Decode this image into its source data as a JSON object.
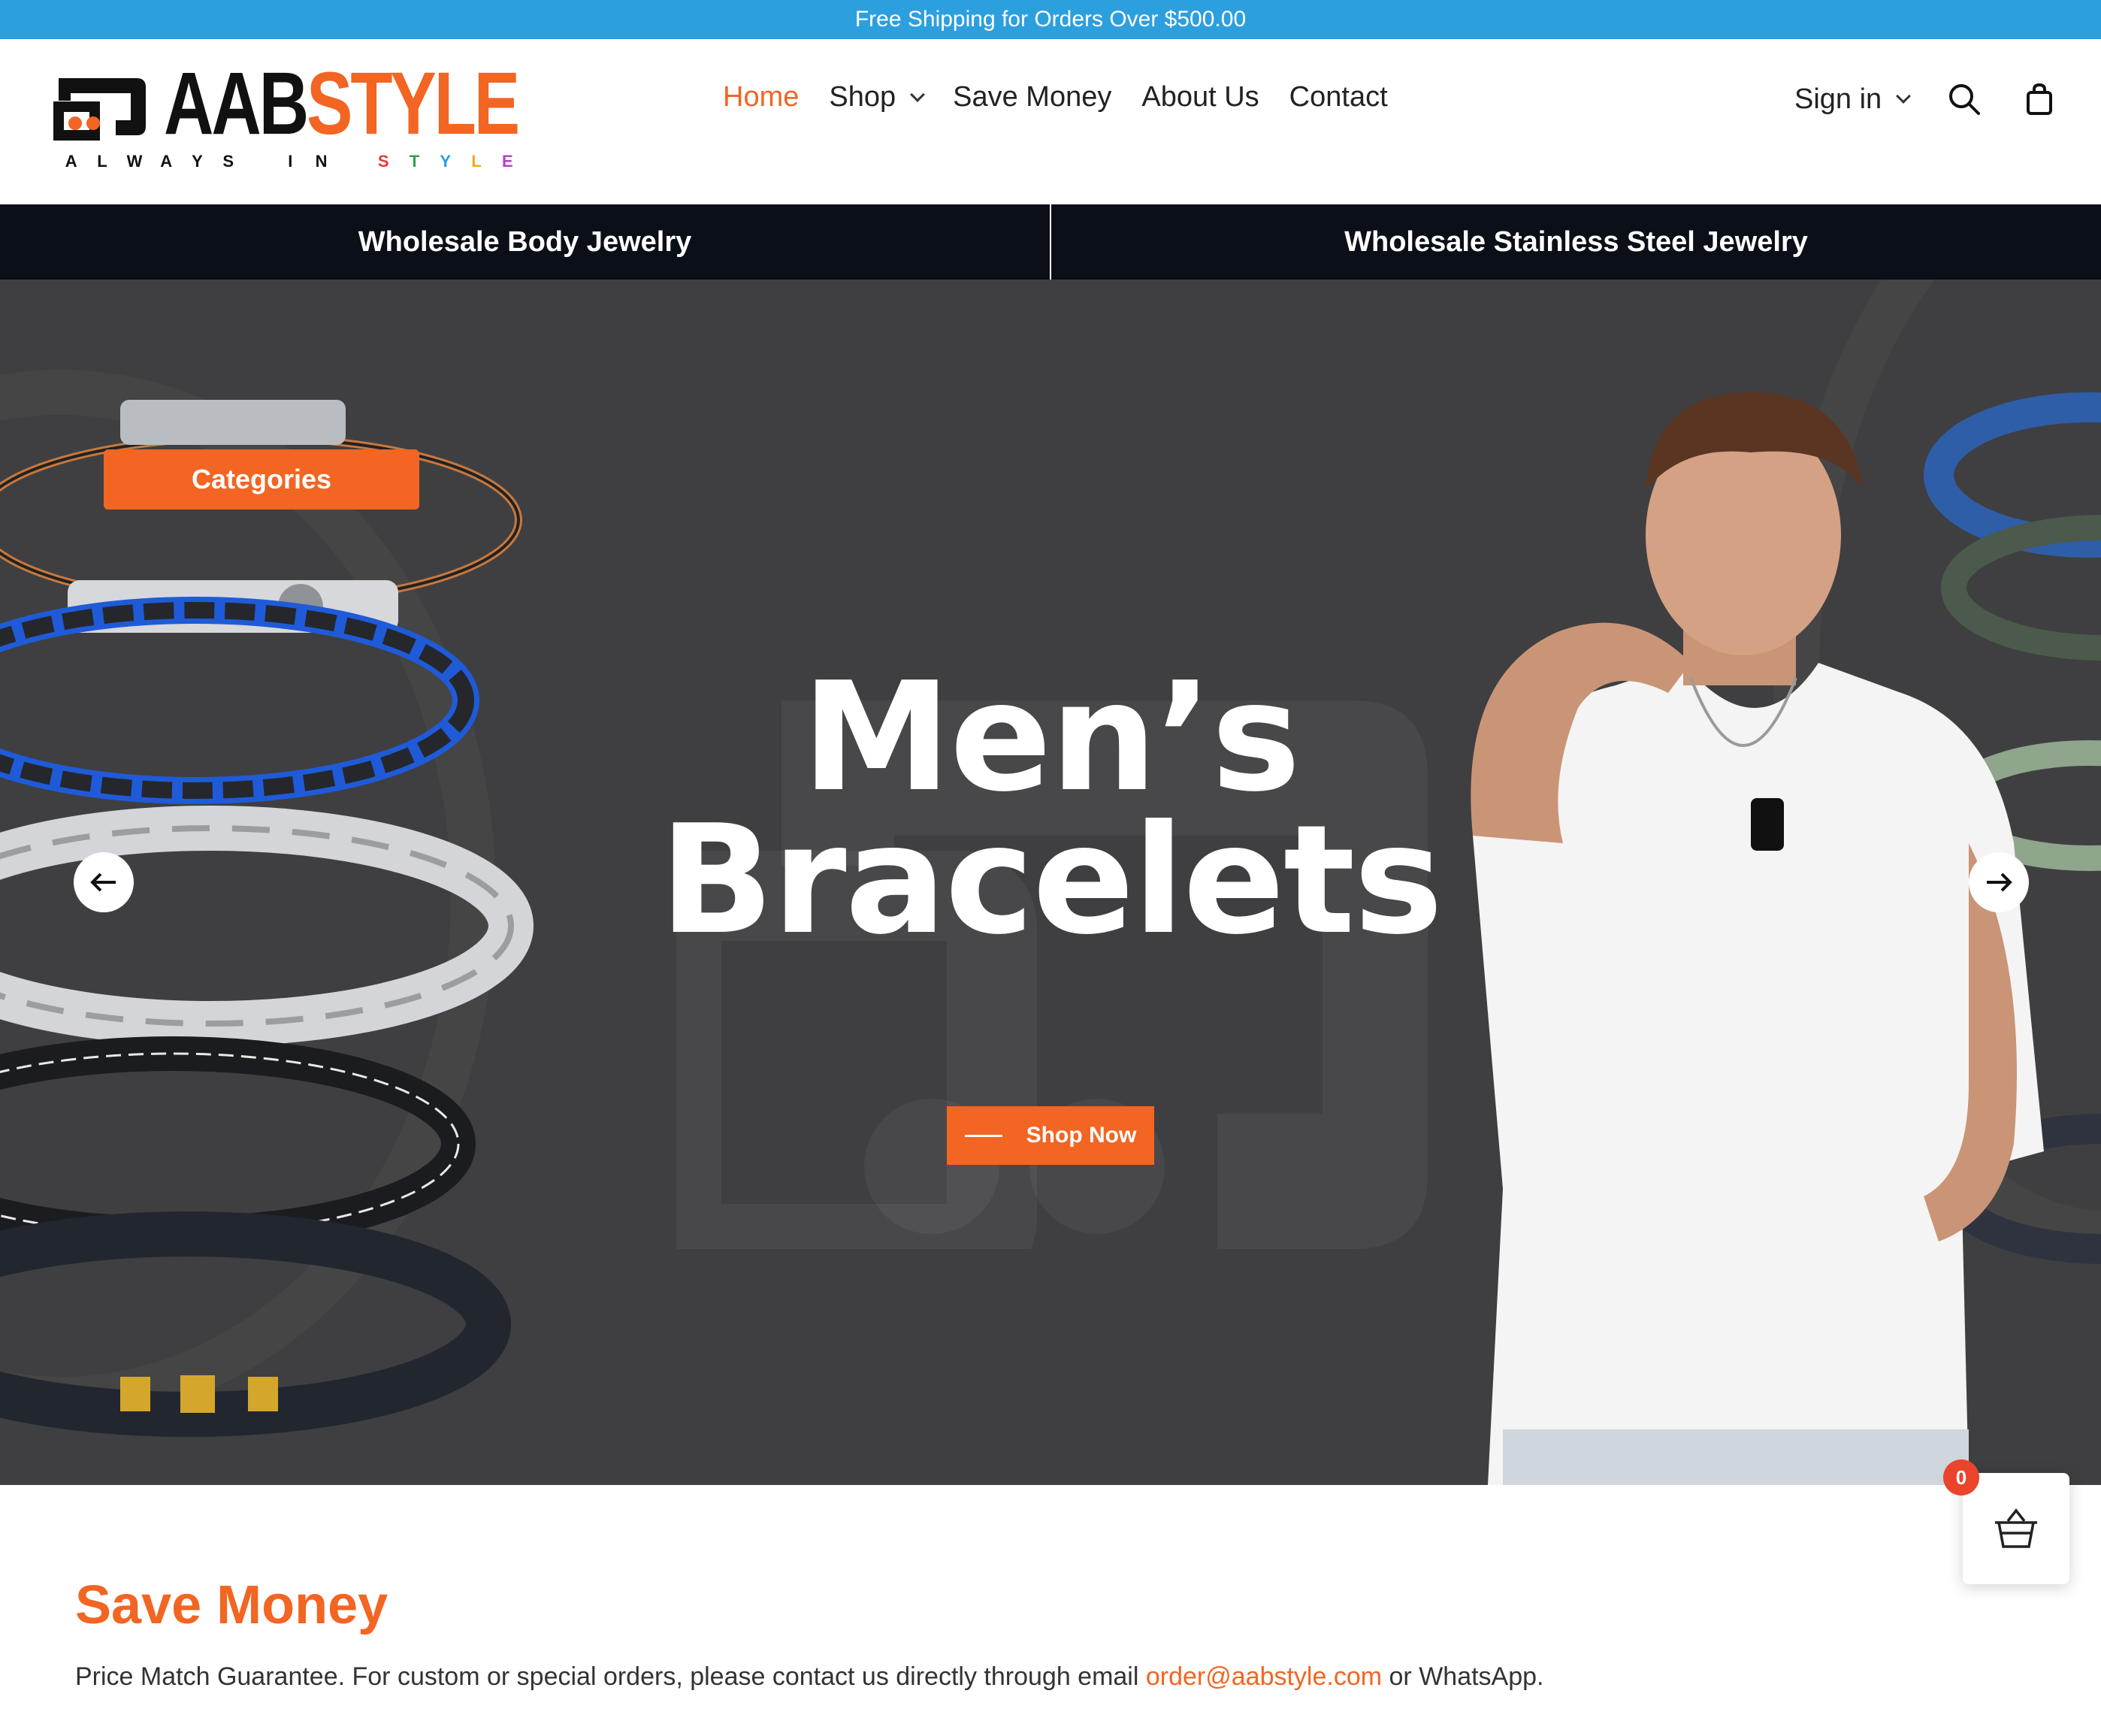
{
  "announcement": {
    "text": "Free Shipping for Orders Over $500.00"
  },
  "logo": {
    "brand_a": "AAB",
    "brand_b": "STYLE",
    "tagline_letters": [
      "A",
      "L",
      "W",
      "A",
      "Y",
      "S",
      "",
      "I",
      "N",
      "",
      "S",
      "T",
      "Y",
      "L",
      "E"
    ],
    "accent_color": "#f26522"
  },
  "nav": {
    "items": [
      {
        "label": "Home",
        "active": true
      },
      {
        "label": "Shop",
        "has_dropdown": true
      },
      {
        "label": "Save Money"
      },
      {
        "label": "About Us"
      },
      {
        "label": "Contact"
      }
    ]
  },
  "header_tools": {
    "signin_label": "Sign in",
    "search_icon": "search-icon",
    "cart_icon": "shopping-bag-icon"
  },
  "category_bar": {
    "left": "Wholesale Body Jewelry",
    "right": "Wholesale Stainless Steel Jewelry"
  },
  "hero": {
    "title_line1": "Men’s",
    "title_line2": "Bracelets",
    "cta_label": "Shop Now",
    "categories_label": "Categories",
    "prev_icon": "arrow-left-icon",
    "next_icon": "arrow-right-icon",
    "background_color": "#3f3f41"
  },
  "floating_cart": {
    "count": "0",
    "icon": "basket-icon"
  },
  "save_money": {
    "heading": "Save Money",
    "text_before": "Price Match Guarantee. For custom or special orders, please contact us directly through email ",
    "email": "order@aabstyle.com",
    "text_after": " or WhatsApp."
  },
  "colors": {
    "announce_bg": "#2c9fde",
    "accent": "#f26522",
    "dark_bar": "#0b0f17"
  }
}
